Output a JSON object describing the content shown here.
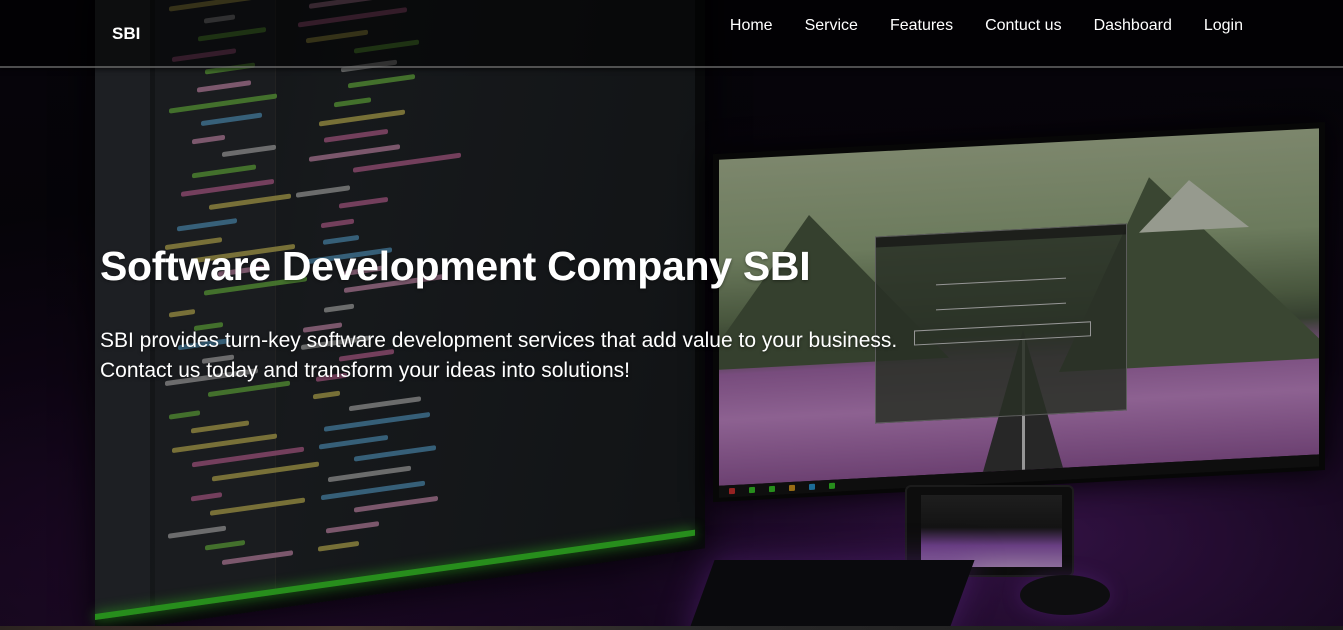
{
  "navbar": {
    "brand": "SBI",
    "links": [
      {
        "label": "Home"
      },
      {
        "label": "Service"
      },
      {
        "label": "Features"
      },
      {
        "label": "Contuct us"
      },
      {
        "label": "Dashboard"
      },
      {
        "label": "Login"
      }
    ]
  },
  "hero": {
    "title": "Software Development Company SBI",
    "description_line1": "SBI provides turn-key software development services that add value to your business.",
    "description_line2": "Contact us today and transform your ideas into solutions!",
    "background_image": "dark desk setup with code monitor and mountain wallpaper monitor in purple light"
  },
  "colors": {
    "nav_text": "#ffffff",
    "hero_text": "#ffffff",
    "accent_green": "#3ad22a",
    "accent_purple": "#b070b8"
  }
}
